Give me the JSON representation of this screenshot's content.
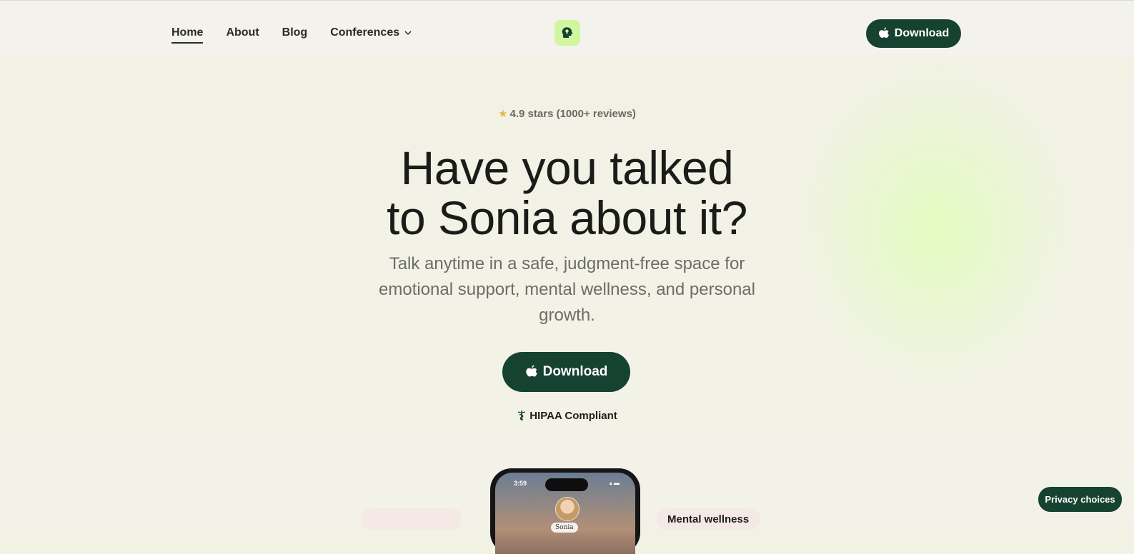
{
  "nav": {
    "items": [
      {
        "label": "Home",
        "active": true
      },
      {
        "label": "About"
      },
      {
        "label": "Blog"
      },
      {
        "label": "Conferences",
        "has_dropdown": true
      }
    ]
  },
  "header": {
    "logo_icon": "head-with-lightbulb-icon",
    "download_label": "Download",
    "download_icon": "apple-icon"
  },
  "hero": {
    "rating": "4.9 stars (1000+ reviews)",
    "rating_icon": "star-icon",
    "rating_icon_color": "#f0b43c",
    "headline_line1": "Have you talked",
    "headline_line2": "to Sonia about it?",
    "subheadline_line1": "Talk anytime in a safe, judgment-free space for",
    "subheadline_line2": "emotional support, mental wellness, and personal",
    "subheadline_line3": "growth.",
    "download_label": "Download",
    "hipaa_label": "HIPAA Compliant",
    "hipaa_icon": "caduceus-icon"
  },
  "phone": {
    "time": "3:59",
    "contact_name": "Sonia"
  },
  "chips": {
    "right_label": "Mental wellness"
  },
  "privacy": {
    "label": "Privacy choices"
  },
  "colors": {
    "primary": "#164231",
    "background": "#f1f1e4",
    "logo_bg": "#d2f5a0",
    "glow": "#e2fcbe"
  }
}
